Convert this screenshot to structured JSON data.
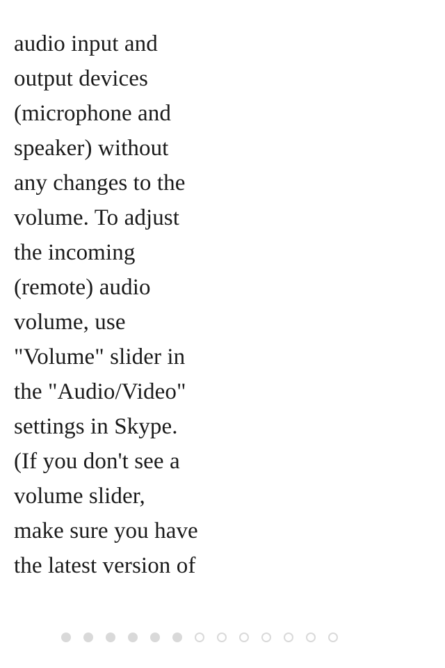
{
  "content": {
    "lines": [
      "audio input and",
      "output devices",
      "(microphone and",
      "speaker) without",
      "any changes to the",
      "volume. To adjust",
      "the incoming",
      "(remote) audio",
      "volume, use",
      "\"Volume\" slider in",
      "the \"Audio/Video\"",
      "settings in Skype.",
      "(If you don't see a",
      "volume slider,",
      "make sure you have",
      "the latest version of"
    ]
  },
  "pager": {
    "total_pages": 13,
    "filled_count": 6,
    "colors": {
      "dot": "#d9d9d9",
      "background": "#ffffff"
    },
    "icon": "page-indicator-dot"
  }
}
